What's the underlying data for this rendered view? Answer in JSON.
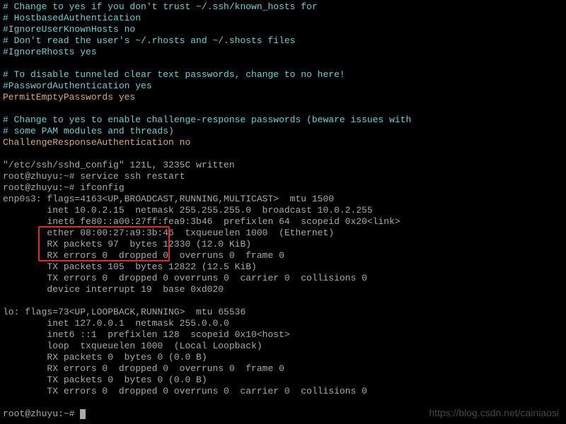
{
  "lines": {
    "l0": "# Change to yes if you don't trust ~/.ssh/known_hosts for",
    "l1": "# HostbasedAuthentication",
    "l2": "#IgnoreUserKnownHosts no",
    "l3": "# Don't read the user's ~/.rhosts and ~/.shosts files",
    "l4": "#IgnoreRhosts yes",
    "l5": " ",
    "l6": "# To disable tunneled clear text passwords, change to no here!",
    "l7": "#PasswordAuthentication yes",
    "l8": "PermitEmptyPasswords yes",
    "l9": " ",
    "l10": "# Change to yes to enable challenge-response passwords (beware issues with",
    "l11": "# some PAM modules and threads)",
    "l12": "ChallengeResponseAuthentication no",
    "l13": " ",
    "l14": "\"/etc/ssh/sshd_config\" 121L, 3235C written",
    "l15": "root@zhuyu:~# service ssh restart",
    "l16": "root@zhuyu:~# ifconfig",
    "l17": "enp0s3: flags=4163<UP,BROADCAST,RUNNING,MULTICAST>  mtu 1500",
    "l18": "        inet 10.0.2.15  netmask 255.255.255.0  broadcast 10.0.2.255",
    "l19": "        inet6 fe80::a00:27ff:fea9:3b46  prefixlen 64  scopeid 0x20<link>",
    "l20": "        ether 08:00:27:a9:3b:46  txqueuelen 1000  (Ethernet)",
    "l21": "        RX packets 97  bytes 12330 (12.0 KiB)",
    "l22": "        RX errors 0  dropped 0  overruns 0  frame 0",
    "l23": "        TX packets 105  bytes 12822 (12.5 KiB)",
    "l24": "        TX errors 0  dropped 0 overruns 0  carrier 0  collisions 0",
    "l25": "        device interrupt 19  base 0xd020",
    "l26": " ",
    "l27": "lo: flags=73<UP,LOOPBACK,RUNNING>  mtu 65536",
    "l28": "        inet 127.0.0.1  netmask 255.0.0.0",
    "l29": "        inet6 ::1  prefixlen 128  scopeid 0x10<host>",
    "l30": "        loop  txqueuelen 1000  (Local Loopback)",
    "l31": "        RX packets 0  bytes 0 (0.0 B)",
    "l32": "        RX errors 0  dropped 0  overruns 0  frame 0",
    "l33": "        TX packets 0  bytes 0 (0.0 B)",
    "l34": "        TX errors 0  dropped 0 overruns 0  carrier 0  collisions 0",
    "l35": " ",
    "l36": "root@zhuyu:~# "
  },
  "watermark": "https://blog.csdn.net/cainiaosi"
}
